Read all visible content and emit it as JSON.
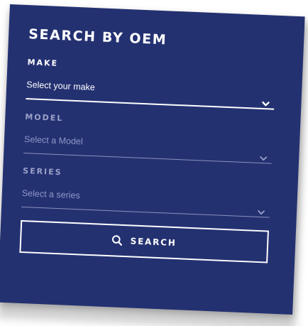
{
  "panel": {
    "title": "SEARCH BY OEM",
    "colors": {
      "background": "#243171",
      "text": "#ffffff",
      "muted": "#9aa1c8"
    }
  },
  "make": {
    "label": "MAKE",
    "value": "Select your make",
    "icon": "chevron-down-icon"
  },
  "model": {
    "label": "MODEL",
    "value": "Select a Model",
    "icon": "chevron-down-icon"
  },
  "series": {
    "label": "SERIES",
    "value": "Select a series",
    "icon": "chevron-down-icon"
  },
  "search": {
    "label": "SEARCH",
    "icon": "search-icon"
  }
}
